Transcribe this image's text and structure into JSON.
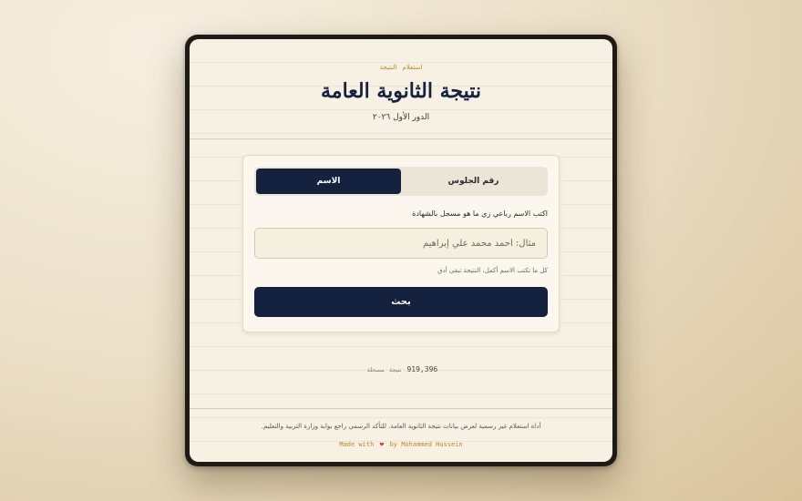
{
  "breadcrumb": {
    "first": "استعلام",
    "second": "النتيجة"
  },
  "header": {
    "title": "نتيجة الثانوية العامة",
    "subtitle": "الدور الأول ٢٠٢٦"
  },
  "tabs": [
    {
      "label": "رقم الجلوس",
      "active": false
    },
    {
      "label": "الاسم",
      "active": true
    }
  ],
  "form": {
    "label": "اكتب الاسم رباعي زي ما هو مسجل بالشهادة",
    "placeholder": "مثال: أحمد محمد علي إبراهيم",
    "value": "",
    "hint": "كل ما تكتب الاسم أكمل، النتيجة تبقى أدق",
    "submit_label": "بحث"
  },
  "stats": {
    "count": "919,396",
    "word1": "نتيجة",
    "word2": "مسجلة"
  },
  "footer": {
    "disclaimer": "أداة استعلام غير رسمية لعرض بيانات نتيجة الثانوية العامة. للتأكد الرسمي راجع بوابة وزارة التربية والتعليم.",
    "credit_prefix": "Made with",
    "credit_suffix": "by Mohammed Hussein"
  },
  "colors": {
    "primary": "#15223f",
    "accent": "#b8892a",
    "heart": "#d33b3b"
  },
  "icons": {
    "heart": "heart-icon"
  }
}
